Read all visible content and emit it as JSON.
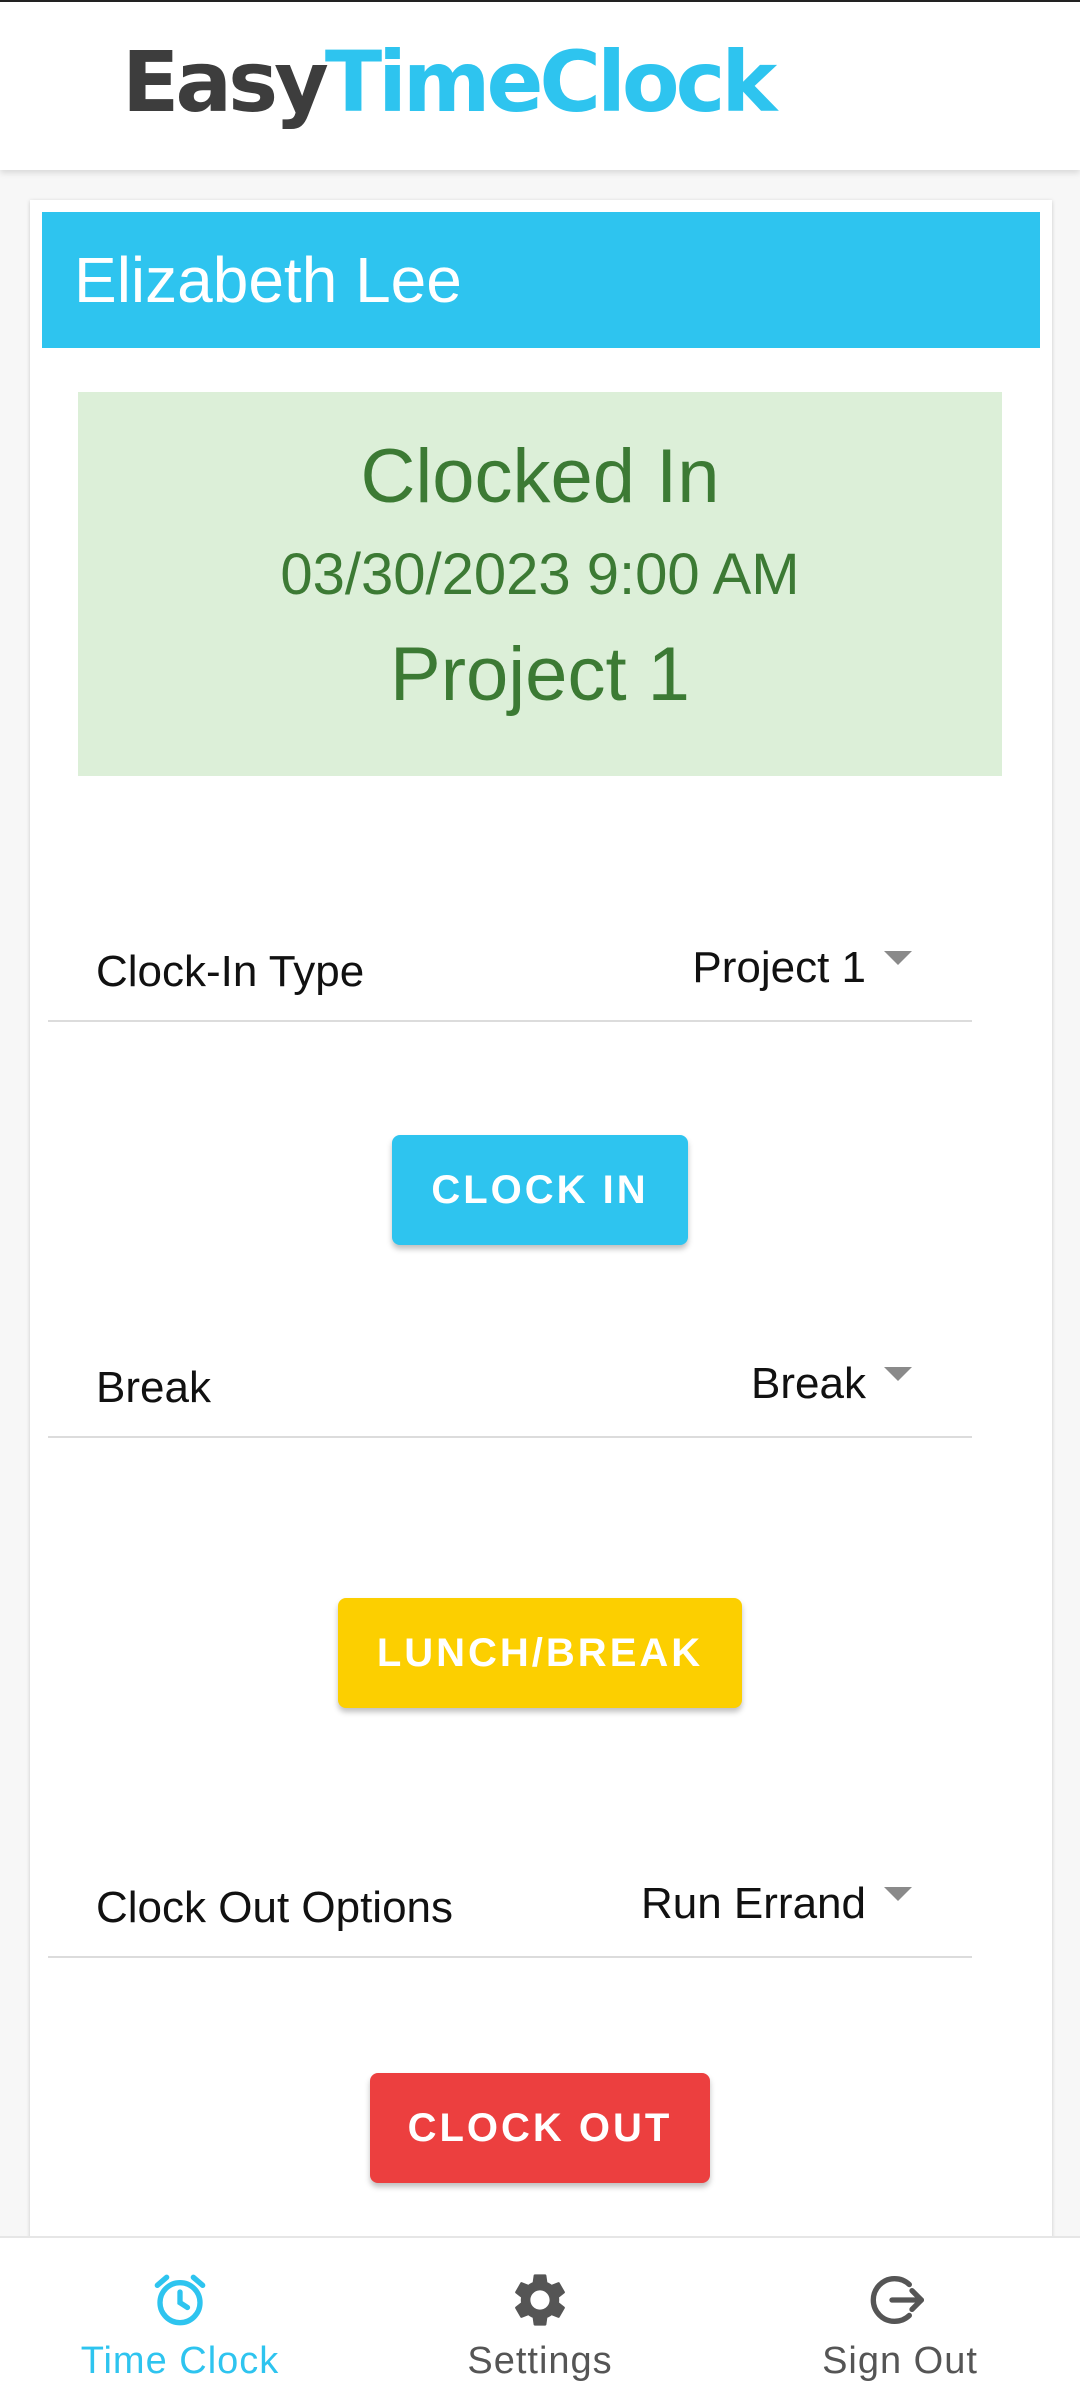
{
  "header": {
    "logo_part1": "Easy",
    "logo_part2": "TimeClock"
  },
  "card": {
    "employee_name": "Elizabeth Lee"
  },
  "status": {
    "state": "Clocked In",
    "datetime": "03/30/2023 9:00 AM",
    "project": "Project 1"
  },
  "clock_in_type": {
    "label": "Clock-In Type",
    "selected": "Project 1"
  },
  "clock_in_button": "CLOCK IN",
  "break": {
    "label": "Break",
    "selected": "Break"
  },
  "break_button": "LUNCH/BREAK",
  "clock_out_options": {
    "label": "Clock Out Options",
    "selected": "Run Errand"
  },
  "clock_out_button": "CLOCK OUT",
  "bottom_nav": {
    "items": [
      {
        "label": "Time Clock",
        "icon": "alarm-clock-icon",
        "active": true
      },
      {
        "label": "Settings",
        "icon": "gear-icon",
        "active": false
      },
      {
        "label": "Sign Out",
        "icon": "sign-out-icon",
        "active": false
      }
    ]
  },
  "colors": {
    "accent": "#2ec4ef",
    "break": "#fccf00",
    "danger": "#ec3f3f",
    "status_bg": "#dcefd8",
    "status_text": "#3c7a34"
  }
}
